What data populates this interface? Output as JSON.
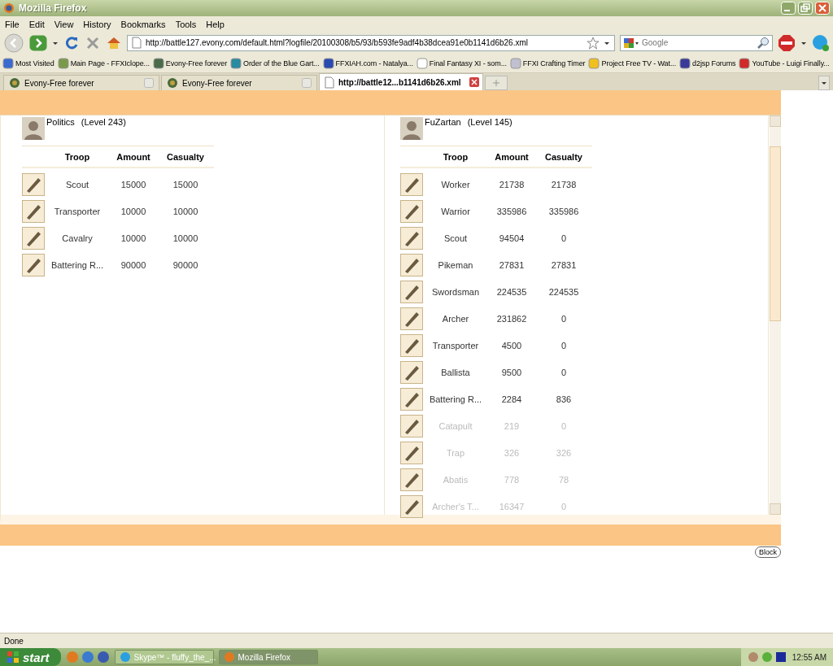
{
  "window": {
    "title": "Mozilla Firefox"
  },
  "menu": [
    "File",
    "Edit",
    "View",
    "History",
    "Bookmarks",
    "Tools",
    "Help"
  ],
  "address": {
    "value": "http://battle127.evony.com/default.html?logfile/20100308/b5/93/b593fe9adf4b38dcea91e0b1141d6b26.xml"
  },
  "search": {
    "placeholder": "Google"
  },
  "bookmarks": [
    "Most Visited",
    "Main Page - FFXIclope...",
    "Evony-Free forever",
    "Order of the Blue Gart...",
    "FFXIAH.com - Natalya...",
    "Final Fantasy XI - som...",
    "FFXI Crafting Timer",
    "Project Free TV - Wat...",
    "d2jsp Forums",
    "YouTube - Luigi Finally..."
  ],
  "tabs": [
    {
      "label": "Evony-Free forever",
      "selected": false
    },
    {
      "label": "Evony-Free forever",
      "selected": false
    },
    {
      "label": "http://battle12...b1141d6b26.xml",
      "selected": true
    }
  ],
  "report": {
    "sides": [
      {
        "commander": "Politics",
        "level": "(Level 243)",
        "columns": [
          "Troop",
          "Amount",
          "Casualty"
        ],
        "rows": [
          {
            "troop": "Scout",
            "amount": "15000",
            "casualty": "15000",
            "faded": false
          },
          {
            "troop": "Transporter",
            "amount": "10000",
            "casualty": "10000",
            "faded": false
          },
          {
            "troop": "Cavalry",
            "amount": "10000",
            "casualty": "10000",
            "faded": false
          },
          {
            "troop": "Battering R...",
            "amount": "90000",
            "casualty": "90000",
            "faded": false
          }
        ]
      },
      {
        "commander": "FuZartan",
        "level": "(Level 145)",
        "columns": [
          "Troop",
          "Amount",
          "Casualty"
        ],
        "rows": [
          {
            "troop": "Worker",
            "amount": "21738",
            "casualty": "21738",
            "faded": false
          },
          {
            "troop": "Warrior",
            "amount": "335986",
            "casualty": "335986",
            "faded": false
          },
          {
            "troop": "Scout",
            "amount": "94504",
            "casualty": "0",
            "faded": false
          },
          {
            "troop": "Pikeman",
            "amount": "27831",
            "casualty": "27831",
            "faded": false
          },
          {
            "troop": "Swordsman",
            "amount": "224535",
            "casualty": "224535",
            "faded": false
          },
          {
            "troop": "Archer",
            "amount": "231862",
            "casualty": "0",
            "faded": false
          },
          {
            "troop": "Transporter",
            "amount": "4500",
            "casualty": "0",
            "faded": false
          },
          {
            "troop": "Ballista",
            "amount": "9500",
            "casualty": "0",
            "faded": false
          },
          {
            "troop": "Battering R...",
            "amount": "2284",
            "casualty": "836",
            "faded": false
          },
          {
            "troop": "Catapult",
            "amount": "219",
            "casualty": "0",
            "faded": true
          },
          {
            "troop": "Trap",
            "amount": "326",
            "casualty": "326",
            "faded": true
          },
          {
            "troop": "Abatis",
            "amount": "778",
            "casualty": "78",
            "faded": true
          },
          {
            "troop": "Archer's T...",
            "amount": "16347",
            "casualty": "0",
            "faded": true
          }
        ]
      }
    ]
  },
  "block_button": "Block",
  "status_bar": "Done",
  "taskbar": {
    "start": "start",
    "items": [
      {
        "label": "Skype™ - fluffy_the_...",
        "selected": false
      },
      {
        "label": "Mozilla Firefox",
        "selected": true
      }
    ],
    "clock": "12:55 AM"
  }
}
